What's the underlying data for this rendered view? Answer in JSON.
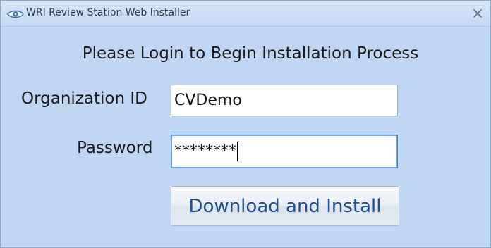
{
  "window": {
    "title": "WRI Review Station Web Installer",
    "app_icon": "eye-icon",
    "close_icon": "close-icon"
  },
  "form": {
    "heading": "Please Login to Begin Installation Process",
    "org_label": "Organization ID",
    "org_value": "CVDemo",
    "password_label": "Password",
    "password_value": "********",
    "install_button_label": "Download and Install"
  },
  "colors": {
    "window_background": "#bfd7f3",
    "title_bar": "#c4daf4",
    "button_text": "#1f4f8c",
    "focus_border": "#3c7fd0"
  }
}
